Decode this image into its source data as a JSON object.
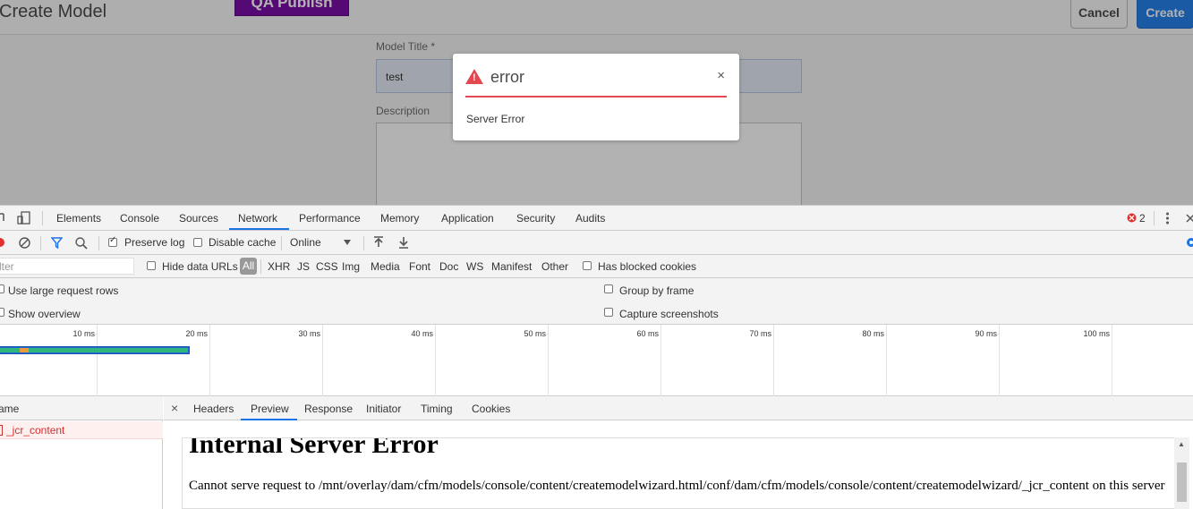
{
  "app": {
    "title": "Create Model",
    "env_badge": "QA Publish",
    "cancel_label": "Cancel",
    "create_label": "Create",
    "model_title_label": "Model Title *",
    "model_title_value": "test",
    "description_label": "Description"
  },
  "dialog": {
    "title": "error",
    "close": "×",
    "message": "Server Error"
  },
  "devtools": {
    "tabs": [
      "Elements",
      "Console",
      "Sources",
      "Network",
      "Performance",
      "Memory",
      "Application",
      "Security",
      "Audits"
    ],
    "active_tab": "Network",
    "error_count": "2",
    "toolbar": {
      "preserve_log": "Preserve log",
      "disable_cache": "Disable cache",
      "throttle": "Online"
    },
    "filter": {
      "placeholder": "lter",
      "hide_data_urls": "Hide data URLs",
      "all": "All",
      "types": [
        "XHR",
        "JS",
        "CSS",
        "Img",
        "Media",
        "Font",
        "Doc",
        "WS",
        "Manifest",
        "Other"
      ],
      "has_blocked_cookies": "Has blocked cookies"
    },
    "settings": {
      "large_rows": "Use large request rows",
      "show_overview": "Show overview",
      "group_by_frame": "Group by frame",
      "capture_screenshots": "Capture screenshots"
    },
    "timeline_ticks": [
      "10 ms",
      "20 ms",
      "30 ms",
      "40 ms",
      "50 ms",
      "60 ms",
      "70 ms",
      "80 ms",
      "90 ms",
      "100 ms"
    ],
    "requests": {
      "header": "ame",
      "rows": [
        "_jcr_content"
      ]
    },
    "detail": {
      "close": "×",
      "tabs": [
        "Headers",
        "Preview",
        "Response",
        "Initiator",
        "Timing",
        "Cookies"
      ],
      "active_tab": "Preview",
      "preview_heading": "Internal Server Error",
      "preview_body": "Cannot serve request to /mnt/overlay/dam/cfm/models/console/content/createmodelwizard.html/conf/dam/cfm/models/console/content/createmodelwizard/_jcr_content on this server"
    }
  }
}
